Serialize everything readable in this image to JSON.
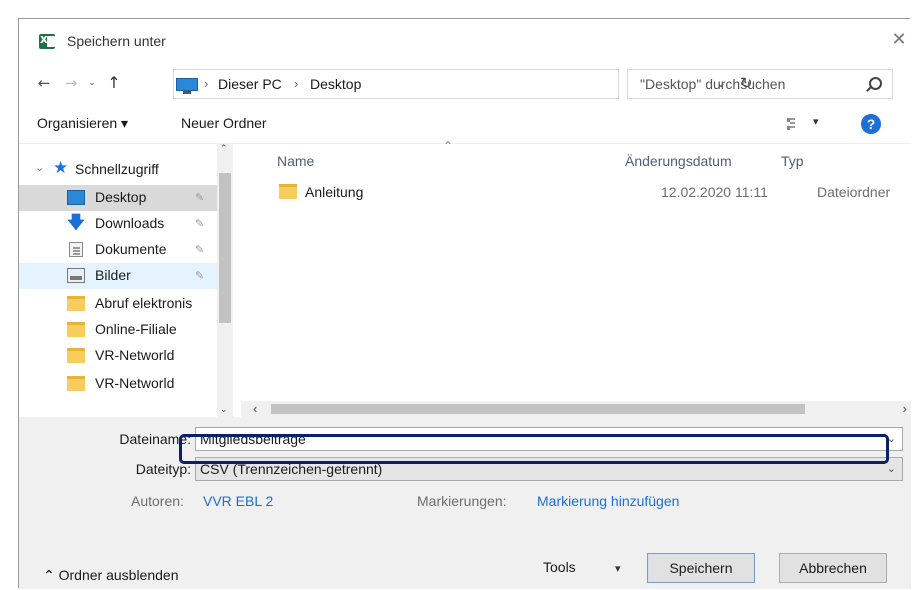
{
  "window": {
    "title": "Speichern unter",
    "close_glyph": "✕",
    "app_icon": "excel-icon"
  },
  "navigation": {
    "back_glyph": "←",
    "forward_glyph": "→",
    "recent_glyph": "⌄",
    "up_glyph": "↑",
    "breadcrumbs": [
      "Dieser PC",
      "Desktop"
    ],
    "breadcrumb_separator": "›",
    "dropdown_glyph": "⌄",
    "refresh_glyph": "↻",
    "search_placeholder": "\"Desktop\" durchsuchen"
  },
  "toolbar": {
    "organize_label": "Organisieren ▾",
    "new_folder_label": "Neuer Ordner",
    "view_dropdown_glyph": "▾",
    "help_glyph": "?"
  },
  "sidebar": {
    "section_chevron": "⌄",
    "section_label": "Schnellzugriff",
    "pin_glyph": "✚",
    "items": [
      {
        "label": "Desktop",
        "icon": "desktop-icon",
        "pinned": true,
        "state": "selected"
      },
      {
        "label": "Downloads",
        "icon": "download-icon",
        "pinned": true,
        "state": ""
      },
      {
        "label": "Dokumente",
        "icon": "document-icon",
        "pinned": true,
        "state": ""
      },
      {
        "label": "Bilder",
        "icon": "pictures-icon",
        "pinned": true,
        "state": "hover"
      },
      {
        "label": "Abruf elektronis",
        "icon": "folder-icon",
        "pinned": false,
        "state": ""
      },
      {
        "label": "Online-Filiale",
        "icon": "folder-icon",
        "pinned": false,
        "state": ""
      },
      {
        "label": "VR-Networld",
        "icon": "folder-icon",
        "pinned": false,
        "state": ""
      },
      {
        "label": "VR-Networld",
        "icon": "folder-icon",
        "pinned": false,
        "state": ""
      }
    ],
    "scroll_up_glyph": "⌃",
    "scroll_down_glyph": "⌄"
  },
  "filelist": {
    "columns": {
      "name": "Name",
      "date": "Änderungsdatum",
      "type": "Typ"
    },
    "sort_glyph": "⌃",
    "rows": [
      {
        "name": "Anleitung",
        "date": "12.02.2020 11:11",
        "type": "Dateiordner",
        "icon": "folder-icon"
      }
    ],
    "scroll_left_glyph": "‹",
    "scroll_right_glyph": "›"
  },
  "form": {
    "filename_label": "Dateiname:",
    "filename_value": "Mitgliedsbeiträge",
    "filetype_label": "Dateityp:",
    "filetype_value": "CSV (Trennzeichen-getrennt)",
    "dropdown_glyph": "⌄",
    "authors_label": "Autoren:",
    "authors_value": "VVR EBL 2",
    "tags_label": "Markierungen:",
    "tags_value": "Markierung hinzufügen"
  },
  "footer": {
    "toggle_label": "⌃  Ordner ausblenden",
    "tools_label": "Tools",
    "tools_dropdown_glyph": "▾",
    "save_label": "Speichern",
    "cancel_label": "Abbrechen"
  },
  "colors": {
    "highlight_ring": "#0a1f6e",
    "link": "#1a6fd8",
    "selected_item": "#d9d9d9",
    "hover_item": "#e5f3ff"
  }
}
